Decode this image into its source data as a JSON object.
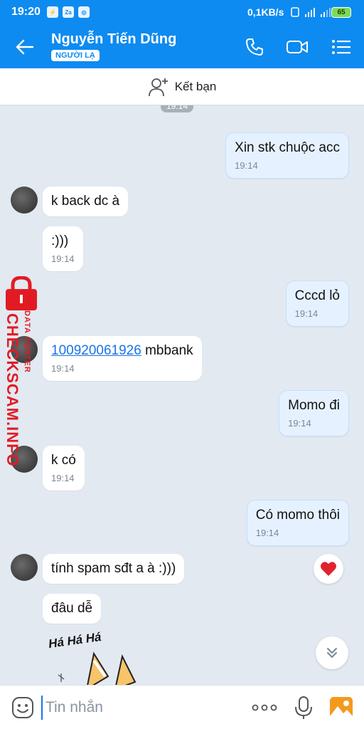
{
  "status_bar": {
    "time": "19:20",
    "network_speed": "0,1KB/s",
    "battery": "65",
    "app_icons": [
      "bolt-icon",
      "zalo-icon",
      "vpn-icon"
    ]
  },
  "header": {
    "contact_name": "Nguyễn Tiến Dũng",
    "badge": "NGƯỜI LẠ",
    "accent_color": "#0d8bf0"
  },
  "add_friend": {
    "label": "Kết bạn"
  },
  "chat": {
    "top_time_pill": "19:14",
    "messages": [
      {
        "direction": "out",
        "text": "Xin stk chuộc acc",
        "time": "19:14"
      },
      {
        "direction": "in",
        "text": "k back dc à",
        "time": ""
      },
      {
        "direction": "in",
        "text": ":)))",
        "time": "19:14"
      },
      {
        "direction": "out",
        "text": "Cccd lỏ",
        "time": "19:14"
      },
      {
        "direction": "in",
        "link": "100920061926",
        "text": " mbbank",
        "time": "19:14"
      },
      {
        "direction": "out",
        "text": "Momo đi",
        "time": "19:14"
      },
      {
        "direction": "in",
        "text": "k có",
        "time": "19:14"
      },
      {
        "direction": "out",
        "text": "Có momo thôi",
        "time": "19:14"
      },
      {
        "direction": "in",
        "text": "tính spam sđt a à :)))",
        "time": ""
      },
      {
        "direction": "in",
        "text": "đâu dễ",
        "time": ""
      }
    ],
    "sticker_text": "Há Há Há"
  },
  "watermark": {
    "main": "CHECKSCAM.INFO",
    "small": "DATA CENTER",
    "color": "#e21b23"
  },
  "input_bar": {
    "placeholder": "Tin nhắn"
  }
}
